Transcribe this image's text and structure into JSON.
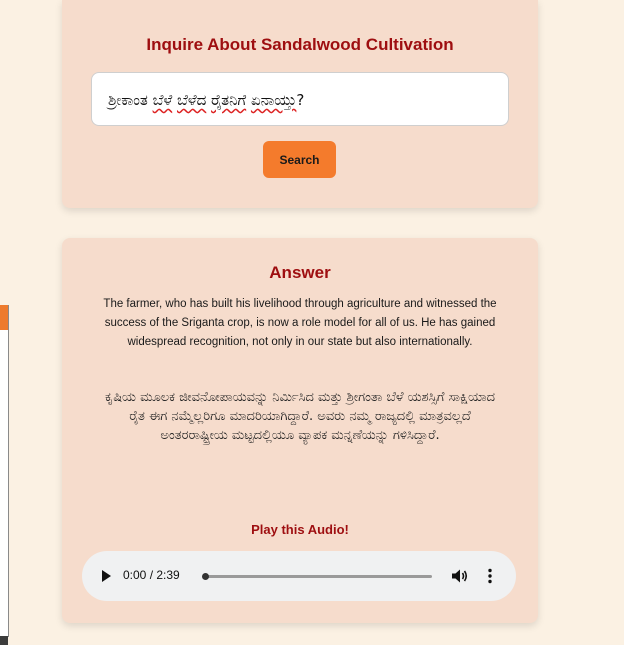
{
  "inquiry": {
    "title": "Inquire About Sandalwood Cultivation",
    "search_value_part1": "ಶ್ರೀಕಾಂತ ",
    "search_value_part2": "ಬೆಳೆ",
    "search_value_part3": " ",
    "search_value_part4": "ಬೆಳೆದ",
    "search_value_part5": " ",
    "search_value_part6": "ರೈತನಿಗೆ",
    "search_value_part7": " ",
    "search_value_part8": "ಏನಾಯ್ತು",
    "search_value_part9": "?",
    "search_button": "Search"
  },
  "answer": {
    "title": "Answer",
    "english_text": "The farmer, who has built his livelihood through agriculture and witnessed the success of the Sriganta crop, is now a role model for all of us. He has gained widespread recognition, not only in our state but also internationally.",
    "kannada_text": "ಕೃಷಿಯ ಮೂಲಕ ಜೀವನೋಪಾಯವನ್ನು ನಿರ್ಮಿಸಿದ ಮತ್ತು ಶ್ರೀಗಂತಾ ಬೆಳೆ ಯಶಸ್ಸಿಗೆ ಸಾಕ್ಷಿಯಾದ ರೈತ ಈಗ ನಮ್ಮೆಲ್ಲರಿಗೂ ಮಾದರಿಯಾಗಿದ್ದಾರೆ. ಅವರು ನಮ್ಮ ರಾಜ್ಯದಲ್ಲಿ ಮಾತ್ರವಲ್ಲದೆ ಅಂತರರಾಷ್ಟ್ರೀಯ ಮಟ್ಟದಲ್ಲಿಯೂ ವ್ಯಾಪಕ ಮನ್ನಣೆಯನ್ನು ಗಳಿಸಿದ್ದಾರೆ.",
    "play_label": "Play this Audio!"
  },
  "audio": {
    "time": "0:00 / 2:39",
    "progress_fraction": 0,
    "icons": {
      "play": "play-icon",
      "volume": "volume-icon",
      "more": "more-options-icon"
    }
  },
  "colors": {
    "background": "#fbf1e3",
    "card": "#f6dccc",
    "accent": "#9e0e10",
    "button": "#f47b2c"
  }
}
